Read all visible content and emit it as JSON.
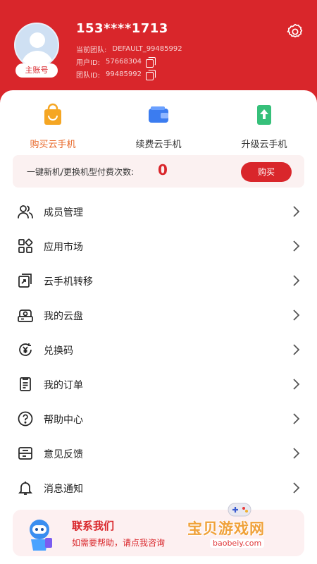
{
  "header": {
    "phone": "153****1713",
    "main_badge": "主账号",
    "team_current_label": "当前团队:",
    "team_current_value": "DEFAULT_99485992",
    "user_id_label": "用户ID:",
    "user_id_value": "57668304",
    "team_id_label": "团队ID:",
    "team_id_value": "99485992"
  },
  "quick_actions": [
    {
      "label": "购买云手机",
      "icon": "shopping-bag-icon",
      "color": "#f5a623"
    },
    {
      "label": "续费云手机",
      "icon": "wallet-icon",
      "color": "#3b7cf0"
    },
    {
      "label": "升级云手机",
      "icon": "upgrade-icon",
      "color": "#36c07a"
    }
  ],
  "promo": {
    "text": "一键新机/更换机型付费次数:",
    "count": "0",
    "button": "购买"
  },
  "menu": [
    {
      "label": "成员管理",
      "icon": "members-icon"
    },
    {
      "label": "应用市场",
      "icon": "app-market-icon"
    },
    {
      "label": "云手机转移",
      "icon": "transfer-icon"
    },
    {
      "label": "我的云盘",
      "icon": "cloud-disk-icon"
    },
    {
      "label": "兑换码",
      "icon": "redeem-code-icon"
    },
    {
      "label": "我的订单",
      "icon": "orders-icon"
    },
    {
      "label": "帮助中心",
      "icon": "help-icon"
    },
    {
      "label": "意见反馈",
      "icon": "feedback-icon"
    },
    {
      "label": "消息通知",
      "icon": "bell-icon"
    }
  ],
  "contact": {
    "title": "联系我们",
    "subtitle": "如需要帮助，请点我咨询"
  },
  "watermark": {
    "text": "宝贝游戏网",
    "url": "baobeiy.com"
  },
  "colors": {
    "brand_red": "#d9262b",
    "accent_orange": "#e8692a"
  }
}
